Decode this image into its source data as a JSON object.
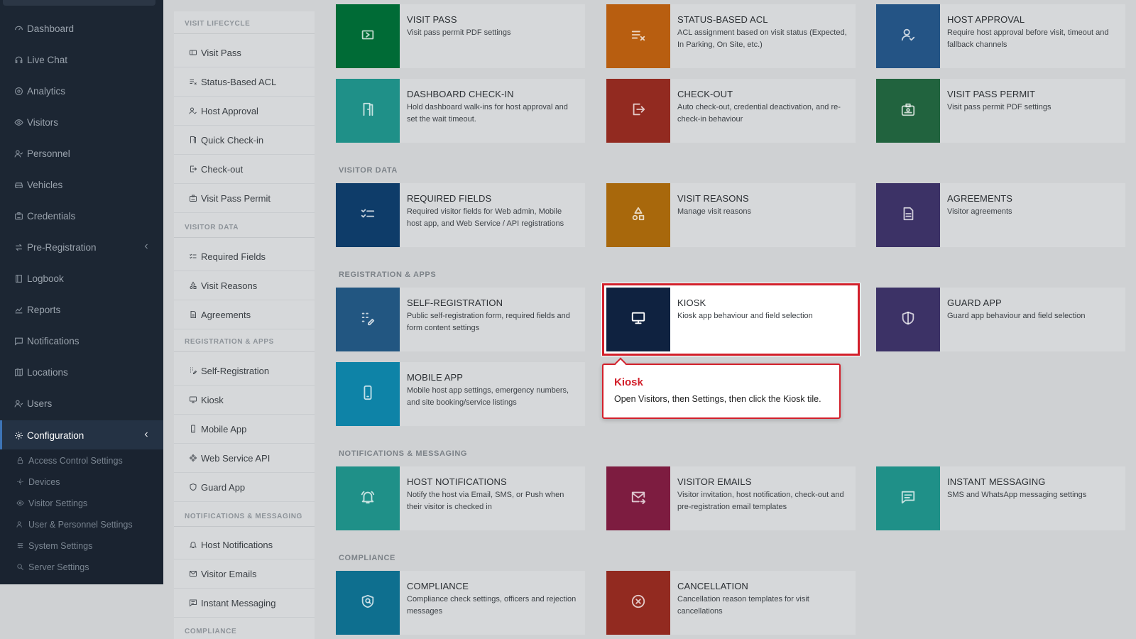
{
  "sidebar": {
    "items": [
      {
        "label": "Dashboard",
        "icon": "dashboard-icon"
      },
      {
        "label": "Live Chat",
        "icon": "headset-icon"
      },
      {
        "label": "Analytics",
        "icon": "target-icon"
      },
      {
        "label": "Visitors",
        "icon": "eye-icon"
      },
      {
        "label": "Personnel",
        "icon": "person-check-icon"
      },
      {
        "label": "Vehicles",
        "icon": "car-icon"
      },
      {
        "label": "Credentials",
        "icon": "id-card-icon"
      },
      {
        "label": "Pre-Registration",
        "icon": "arrows-icon"
      },
      {
        "label": "Logbook",
        "icon": "book-icon"
      },
      {
        "label": "Reports",
        "icon": "chart-icon"
      },
      {
        "label": "Notifications",
        "icon": "message-icon"
      },
      {
        "label": "Locations",
        "icon": "map-icon"
      },
      {
        "label": "Users",
        "icon": "users-icon"
      },
      {
        "label": "Configuration",
        "icon": "gear-icon"
      }
    ],
    "subitems": [
      {
        "label": "Access Control Settings",
        "icon": "lock-icon"
      },
      {
        "label": "Devices",
        "icon": "devices-icon"
      },
      {
        "label": "Visitor Settings",
        "icon": "eye-icon"
      },
      {
        "label": "User & Personnel Settings",
        "icon": "users-icon"
      },
      {
        "label": "System Settings",
        "icon": "sliders-icon"
      },
      {
        "label": "Server Settings",
        "icon": "server-icon"
      }
    ]
  },
  "secmenu": {
    "sections": {
      "lifecycle": "VISIT LIFECYCLE",
      "data": "VISITOR DATA",
      "registration": "REGISTRATION & APPS",
      "notifications": "NOTIFICATIONS & MESSAGING",
      "compliance": "COMPLIANCE"
    },
    "items": [
      {
        "label": "Visit Pass",
        "icon": "ticket-icon"
      },
      {
        "label": "Status-Based ACL",
        "icon": "list-check-icon"
      },
      {
        "label": "Host Approval",
        "icon": "user-check-icon"
      },
      {
        "label": "Quick Check-in",
        "icon": "door-icon"
      },
      {
        "label": "Check-out",
        "icon": "logout-icon"
      },
      {
        "label": "Visit Pass Permit",
        "icon": "badge-icon"
      },
      {
        "label": "Required Fields",
        "icon": "checklist-icon"
      },
      {
        "label": "Visit Reasons",
        "icon": "shapes-icon"
      },
      {
        "label": "Agreements",
        "icon": "document-icon"
      },
      {
        "label": "Self-Registration",
        "icon": "grid-edit-icon"
      },
      {
        "label": "Kiosk",
        "icon": "monitor-icon"
      },
      {
        "label": "Mobile App",
        "icon": "phone-icon"
      },
      {
        "label": "Web Service API",
        "icon": "api-icon"
      },
      {
        "label": "Guard App",
        "icon": "shield-icon"
      },
      {
        "label": "Host Notifications",
        "icon": "bell-icon"
      },
      {
        "label": "Visitor Emails",
        "icon": "mail-icon"
      },
      {
        "label": "Instant Messaging",
        "icon": "chat-icon"
      }
    ]
  },
  "content": {
    "groups": {
      "data": "VISITOR DATA",
      "registration": "REGISTRATION & APPS",
      "notifications": "NOTIFICATIONS & MESSAGING",
      "compliance": "COMPLIANCE"
    },
    "tiles": [
      {
        "title": "VISIT PASS",
        "desc": "Visit pass permit PDF settings",
        "color": "#006b36",
        "icon": "ticket-icon"
      },
      {
        "title": "STATUS-BASED ACL",
        "desc": "ACL assignment based on visit status (Expected, In Parking, On Site, etc.)",
        "color": "#b85e10",
        "icon": "list-check-icon"
      },
      {
        "title": "HOST APPROVAL",
        "desc": "Require host approval before visit, timeout and fallback channels",
        "color": "#245485",
        "icon": "user-check-icon"
      },
      {
        "title": "DASHBOARD CHECK-IN",
        "desc": "Hold dashboard walk-ins for host approval and set the wait timeout.",
        "color": "#1f9088",
        "icon": "door-icon"
      },
      {
        "title": "CHECK-OUT",
        "desc": "Auto check-out, credential deactivation, and re-check-in behaviour",
        "color": "#922a20",
        "icon": "logout-icon"
      },
      {
        "title": "VISIT PASS PERMIT",
        "desc": "Visit pass permit PDF settings",
        "color": "#21633e",
        "icon": "badge-icon"
      },
      {
        "title": "REQUIRED FIELDS",
        "desc": "Required visitor fields for Web admin, Mobile host app, and Web Service / API registrations",
        "color": "#0e3c69",
        "icon": "checklist-icon"
      },
      {
        "title": "VISIT REASONS",
        "desc": "Manage visit reasons",
        "color": "#a8680c",
        "icon": "shapes-icon"
      },
      {
        "title": "AGREEMENTS",
        "desc": "Visitor agreements",
        "color": "#3c3266",
        "icon": "document-icon"
      },
      {
        "title": "SELF-REGISTRATION",
        "desc": "Public self-registration form, required fields and form content settings",
        "color": "#225681",
        "icon": "grid-edit-icon"
      },
      {
        "title": "KIOSK",
        "desc": "Kiosk app behaviour and field selection",
        "color": "#0f2240",
        "icon": "monitor-icon"
      },
      {
        "title": "GUARD APP",
        "desc": "Guard app behaviour and field selection",
        "color": "#3c3266",
        "icon": "shield-icon"
      },
      {
        "title": "MOBILE APP",
        "desc": "Mobile host app settings, emergency numbers, and site booking/service listings",
        "color": "#0e83a7",
        "icon": "phone-icon"
      },
      {
        "title": "HOST NOTIFICATIONS",
        "desc": "Notify the host via Email, SMS, or Push when their visitor is checked in",
        "color": "#1f9088",
        "icon": "bell-icon"
      },
      {
        "title": "VISITOR EMAILS",
        "desc": "Visitor invitation, host notification, check-out and pre-registration email templates",
        "color": "#7d1c40",
        "icon": "mail-icon"
      },
      {
        "title": "INSTANT MESSAGING",
        "desc": "SMS and WhatsApp messaging settings",
        "color": "#1f9088",
        "icon": "chat-icon"
      },
      {
        "title": "COMPLIANCE",
        "desc": "Compliance check settings, officers and rejection messages",
        "color": "#0e6f8f",
        "icon": "shield-search-icon"
      },
      {
        "title": "CANCELLATION",
        "desc": "Cancellation reason templates for visit cancellations",
        "color": "#922a20",
        "icon": "x-circle-icon"
      }
    ]
  },
  "tooltip": {
    "title": "Kiosk",
    "text": "Open Visitors, then Settings, then click the Kiosk tile."
  }
}
